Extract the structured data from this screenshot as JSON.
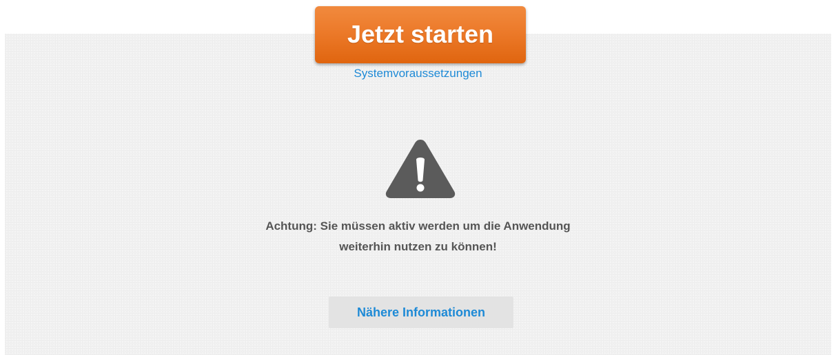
{
  "header": {
    "start_label": "Jetzt starten",
    "system_requirements_link": "Systemvoraussetzungen"
  },
  "warning": {
    "icon": "warning-triangle-icon",
    "message_line1": "Achtung: Sie müssen aktiv werden um die Anwendung",
    "message_line2": "weiterhin nutzen zu können!",
    "more_info_label": "Nähere Informationen"
  },
  "colors": {
    "accent_orange": "#ec7a2a",
    "link_blue": "#1e8ad6",
    "icon_gray": "#5b5b5b",
    "panel_bg": "#f1f1f1"
  }
}
